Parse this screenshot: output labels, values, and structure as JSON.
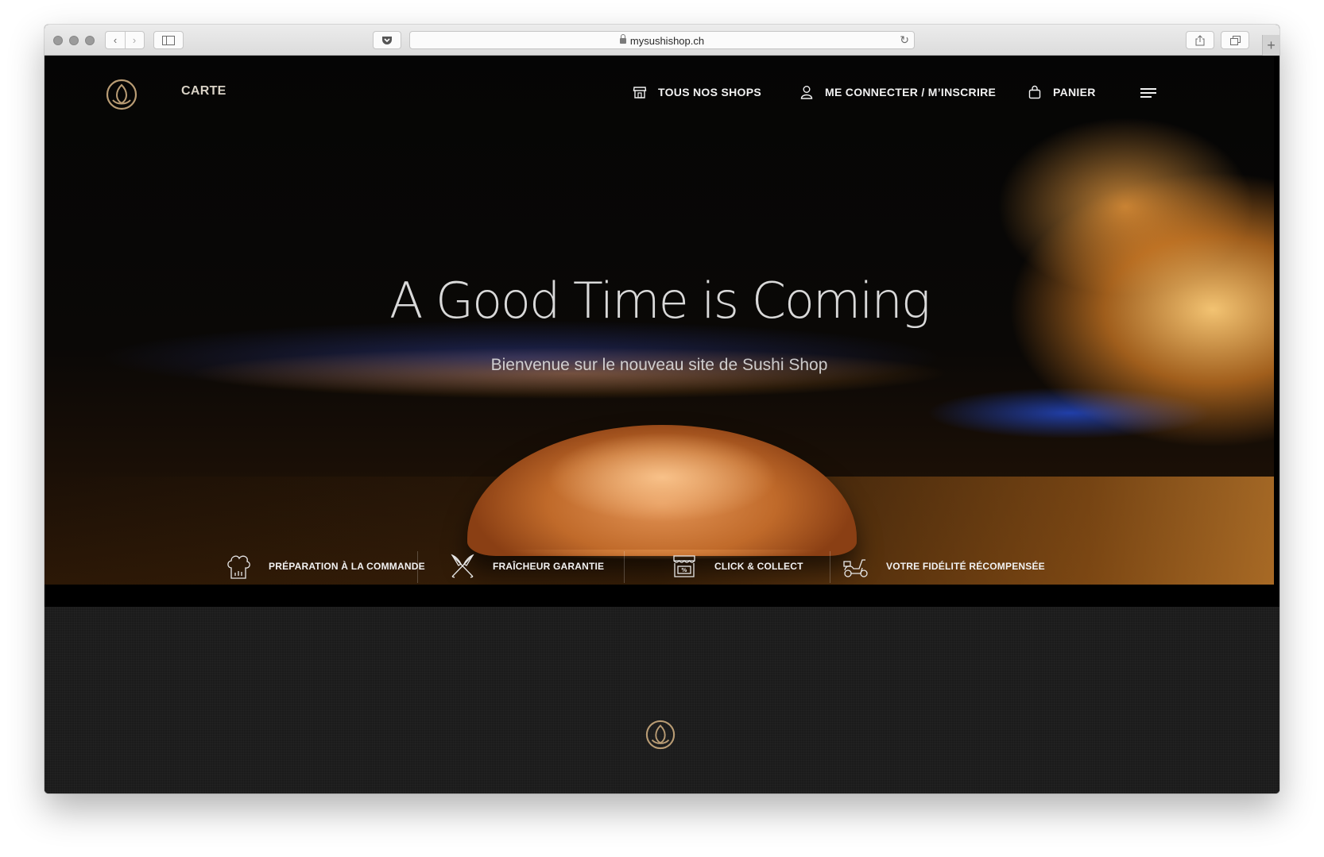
{
  "browser": {
    "url": "mysushishop.ch",
    "new_tab": "+"
  },
  "nav": {
    "carte": "CARTE",
    "shops": "TOUS NOS SHOPS",
    "account": "ME CONNECTER / M’INSCRIRE",
    "cart": "PANIER"
  },
  "hero": {
    "headline": "A Good Time is Coming",
    "subline": "Bienvenue sur le nouveau site de Sushi Shop"
  },
  "features": [
    {
      "label": "PRÉPARATION À LA COMMANDE",
      "icon": "chef-hat-icon"
    },
    {
      "label": "FRAÎCHEUR GARANTIE",
      "icon": "crossed-knives-icon"
    },
    {
      "label": "CLICK & COLLECT",
      "icon": "storefront-icon"
    },
    {
      "label": "VOTRE FIDÉLITÉ RÉCOMPENSÉE",
      "icon": "scooter-icon"
    }
  ],
  "colors": {
    "brand_gold": "#b99c74",
    "nav_text": "#f2f2f2",
    "footer_bg": "#1b1b1b"
  }
}
